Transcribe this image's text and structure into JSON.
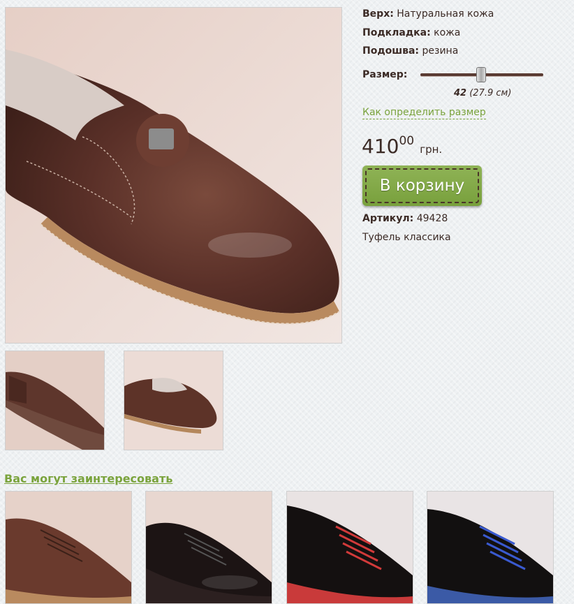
{
  "specs": {
    "upper_label": "Верх:",
    "upper_value": "Натуральная кожа",
    "lining_label": "Подкладка:",
    "lining_value": "кожа",
    "sole_label": "Подошва:",
    "sole_value": "резина"
  },
  "size": {
    "label": "Размер:",
    "value": "42",
    "length": "(27.9 см)",
    "how_to_link": "Как определить размер"
  },
  "price": {
    "integer": "410",
    "decimal": "00",
    "currency": "грн."
  },
  "cart_button": "В корзину",
  "article": {
    "label": "Артикул:",
    "value": "49428"
  },
  "description": "Туфель классика",
  "recommendations": {
    "heading": "Вас могут заинтересовать"
  },
  "colors": {
    "accent_green": "#7aa33c",
    "button_green": "#84aa48",
    "text_brown": "#3b2a25"
  }
}
